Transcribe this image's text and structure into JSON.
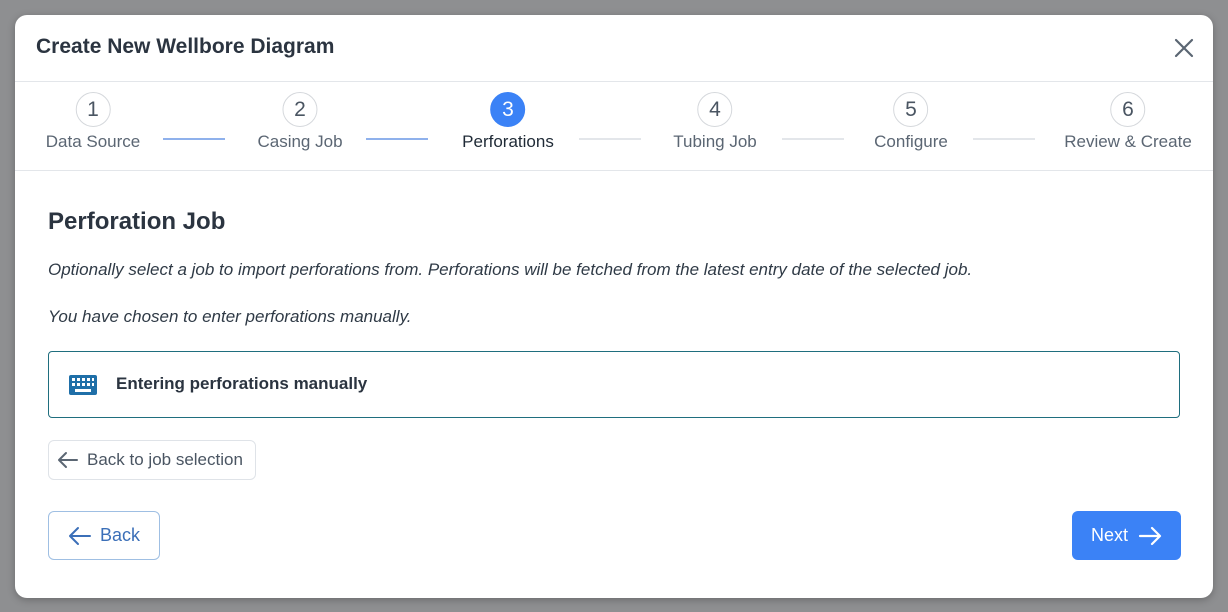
{
  "modal": {
    "title": "Create New Wellbore Diagram"
  },
  "stepper": {
    "steps": [
      {
        "number": "1",
        "label": "Data Source",
        "state": "completed"
      },
      {
        "number": "2",
        "label": "Casing Job",
        "state": "completed"
      },
      {
        "number": "3",
        "label": "Perforations",
        "state": "active"
      },
      {
        "number": "4",
        "label": "Tubing Job",
        "state": "pending"
      },
      {
        "number": "5",
        "label": "Configure",
        "state": "pending"
      },
      {
        "number": "6",
        "label": "Review & Create",
        "state": "pending"
      }
    ]
  },
  "content": {
    "title": "Perforation Job",
    "description": "Optionally select a job to import perforations from. Perforations will be fetched from the latest entry date of the selected job.",
    "manual_notice": "You have chosen to enter perforations manually.",
    "manual_box_label": "Entering perforations manually",
    "manual_box_icon": "keyboard-icon",
    "back_to_selection_label": "Back to job selection"
  },
  "footer": {
    "back_label": "Back",
    "next_label": "Next"
  },
  "colors": {
    "accent": "#3b82f6",
    "manual_box_border": "#1f6e7e",
    "keyboard_icon": "#1f6fa8",
    "connector_done": "#8fb1ec"
  }
}
